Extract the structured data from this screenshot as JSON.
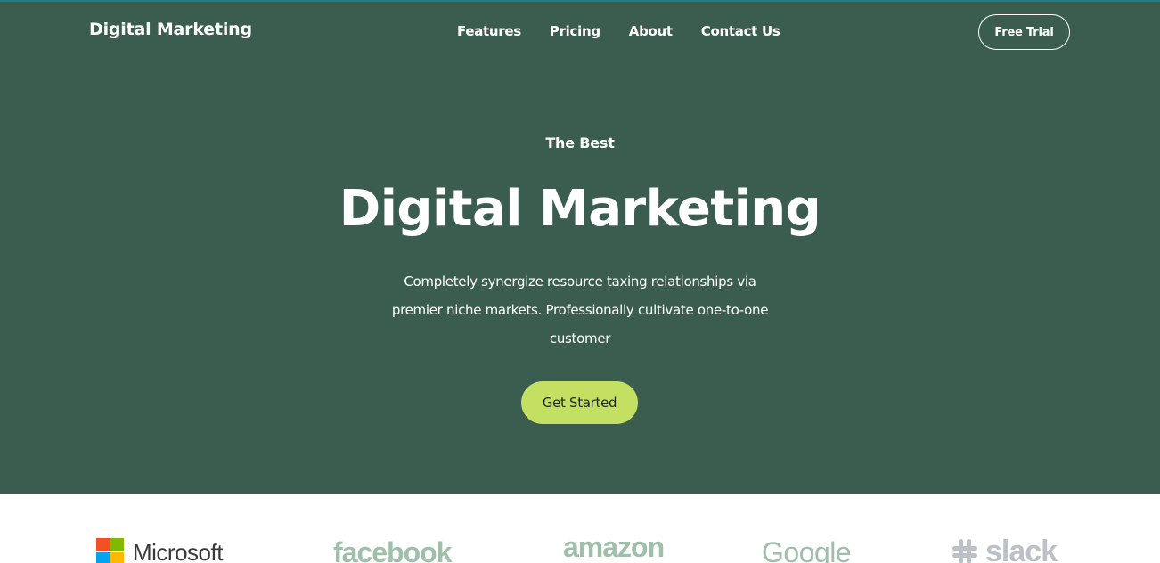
{
  "header": {
    "brand": "Digital Marketing",
    "nav": [
      "Features",
      "Pricing",
      "About",
      "Contact Us"
    ],
    "cta": "Free Trial"
  },
  "hero": {
    "eyebrow": "The Best",
    "headline": "Digital Marketing",
    "subtext": "Completely synergize resource taxing relationships via premier niche markets. Professionally cultivate one-to-one customer",
    "button": "Get Started"
  },
  "logos": [
    {
      "name": "Microsoft",
      "icon": "microsoft-logo"
    },
    {
      "name": "facebook",
      "icon": "facebook-logo"
    },
    {
      "name": "amazon",
      "icon": "amazon-logo"
    },
    {
      "name": "Google",
      "icon": "google-logo"
    },
    {
      "name": "slack",
      "icon": "slack-logo"
    }
  ],
  "colors": {
    "hero_bg": "#3b5d4f",
    "accent": "#c3e062",
    "logo_tint": "#9fbfab"
  }
}
